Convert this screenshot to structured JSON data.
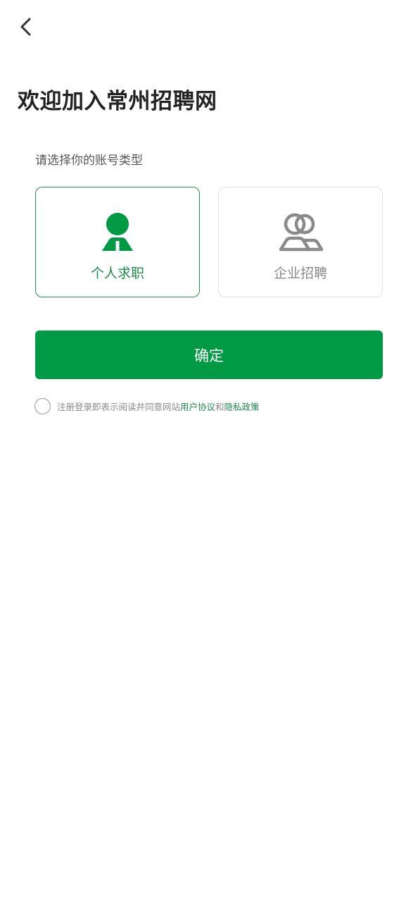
{
  "colors": {
    "brand": "#009944",
    "link": "#1f8a4c",
    "selected_border": "#2e8b57",
    "unselected_border": "#e2e2e2"
  },
  "header": {
    "back_icon": "chevron-left-icon"
  },
  "page": {
    "title": "欢迎加入常州招聘网",
    "section_label": "请选择你的账号类型"
  },
  "account_types": [
    {
      "label": "个人求职",
      "icon": "person-icon",
      "selected": true
    },
    {
      "label": "企业招聘",
      "icon": "group-icon",
      "selected": false
    }
  ],
  "actions": {
    "confirm_label": "确定"
  },
  "agreement": {
    "checked": false,
    "prefix": "注册登录即表示阅读并同意网站",
    "user_agreement": "用户协议",
    "conjunction": "和",
    "privacy_policy": "隐私政策"
  }
}
